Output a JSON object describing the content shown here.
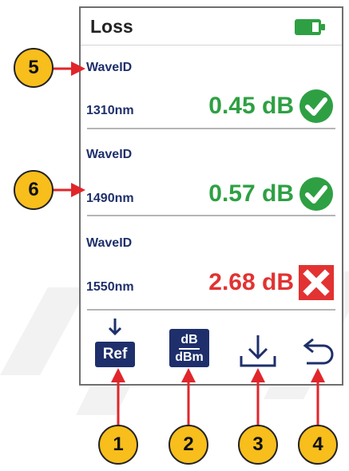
{
  "header": {
    "title": "Loss",
    "battery_icon": "battery-full-icon"
  },
  "rows": [
    {
      "label": "WaveID",
      "wavelength": "1310nm",
      "loss": "0.45 dB",
      "status": "pass",
      "status_icon": "check-circle-icon"
    },
    {
      "label": "WaveID",
      "wavelength": "1490nm",
      "loss": "0.57 dB",
      "status": "pass",
      "status_icon": "check-circle-icon"
    },
    {
      "label": "WaveID",
      "wavelength": "1550nm",
      "loss": "2.68 dB",
      "status": "fail",
      "status_icon": "x-box-icon"
    }
  ],
  "toolbar": {
    "ref_label": "Ref",
    "units_top": "dB",
    "units_bottom": "dBm",
    "save_icon": "download-icon",
    "back_icon": "return-icon"
  },
  "callouts": [
    "1",
    "2",
    "3",
    "4",
    "5",
    "6"
  ],
  "colors": {
    "pass": "#2ea043",
    "fail": "#e23232",
    "navy": "#1e2f6b",
    "badge": "#f7be1c",
    "arrow": "#e0262b",
    "battery": "#2ea043"
  }
}
